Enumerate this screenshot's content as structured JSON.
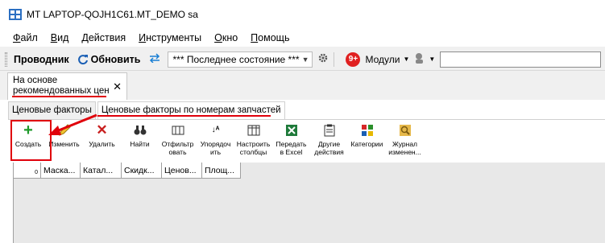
{
  "window": {
    "title": "MT LAPTOP-QOJH1C61.MT_DEMO sa"
  },
  "menu": [
    {
      "u": "Ф",
      "rest": "айл"
    },
    {
      "u": "В",
      "rest": "ид"
    },
    {
      "u": "Д",
      "rest": "ействия"
    },
    {
      "u": "И",
      "rest": "нструменты"
    },
    {
      "u": "О",
      "rest": "кно"
    },
    {
      "u": "П",
      "rest": "омощь"
    }
  ],
  "toolbar": {
    "explorer_label": "Проводник",
    "refresh_label": "Обновить",
    "state_value": "*** Последнее состояние ***",
    "notifications_badge": "9+",
    "modules_label": "Модули",
    "search_value": ""
  },
  "doc_tab": {
    "line1": "На основе",
    "line2": "рекомендованных цен"
  },
  "subtabs": [
    "Ценовые факторы",
    "Ценовые факторы по номерам запчастей"
  ],
  "ribbon": {
    "create": "Создать",
    "edit": "Изменить",
    "delete": "Удалить",
    "find": "Найти",
    "filter_1": "Отфильтр",
    "filter_2": "овать",
    "sort_1": "Упорядоч",
    "sort_2": "ить",
    "columns_1": "Настроить",
    "columns_2": "столбцы",
    "excel_1": "Передать",
    "excel_2": "в Excel",
    "other_1": "Другие",
    "other_2": "действия",
    "categories": "Категории",
    "journal_1": "Журнал",
    "journal_2": "изменен..."
  },
  "grid": {
    "row_count": "0",
    "columns": [
      "Маска...",
      "Катал...",
      "Скидк...",
      "Ценов...",
      "Площ..."
    ]
  },
  "colors": {
    "annotation": "#e0000a",
    "accent_blue": "#1a5fb4"
  }
}
